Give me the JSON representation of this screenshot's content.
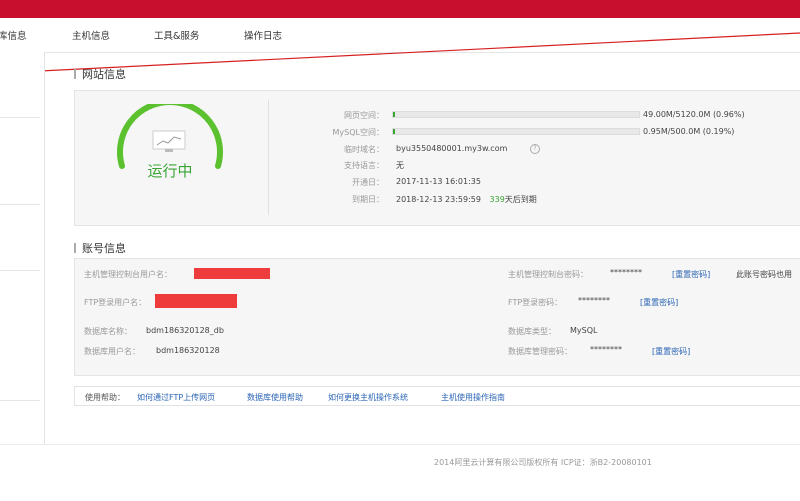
{
  "nav": {
    "items": [
      "库信息",
      "主机信息",
      "工具&服务",
      "操作日志"
    ]
  },
  "site_info": {
    "title": "网站信息",
    "status": "运行中",
    "rows": [
      {
        "label": "网页空间：",
        "value": "49.00M/5120.0M (0.96%)",
        "usage_fraction": 0.0096
      },
      {
        "label": "MySQL空间：",
        "value": "0.95M/500.0M (0.19%)",
        "usage_fraction": 0.0019
      },
      {
        "label": "临时域名：",
        "value": "byu3550480001.my3w.com"
      },
      {
        "label": "支持语言：",
        "value": "无"
      },
      {
        "label": "开通日：",
        "value": "2017-11-13 16:01:35"
      },
      {
        "label": "到期日：",
        "value": "2018-12-13 23:59:59",
        "extra_days": "339",
        "extra_text": "天后到期"
      }
    ]
  },
  "account_info": {
    "title": "账号信息",
    "host_user_label": "主机管理控制台用户名：",
    "host_pwd_label": "主机管理控制台密码：",
    "host_pwd_value": "********",
    "host_reset": "[重置密码]",
    "host_note": "此账号密码也用",
    "ftp_user_label": "FTP登录用户名：",
    "ftp_pwd_label": "FTP登录密码：",
    "ftp_pwd_value": "********",
    "ftp_reset": "[重置密码]",
    "db_name_label": "数据库名称：",
    "db_name_value": "bdm186320128_db",
    "db_type_label": "数据库类型：",
    "db_type_value": "MySQL",
    "db_user_label": "数据库用户名：",
    "db_user_value": "bdm186320128",
    "db_pwd_label": "数据库管理密码：",
    "db_pwd_value": "********",
    "db_reset": "[重置密码]"
  },
  "help": {
    "label": "使用帮助：",
    "links": [
      "如何通过FTP上传网页",
      "数据库使用帮助",
      "如何更换主机操作系统",
      "主机使用操作指南"
    ]
  },
  "footer": {
    "text": "2014阿里云计算有限公司版权所有 ICP证：浙B2-20080101"
  },
  "colors": {
    "brand_red": "#c8102e",
    "ok_green": "#3aa535",
    "link_blue": "#2a64b4"
  }
}
